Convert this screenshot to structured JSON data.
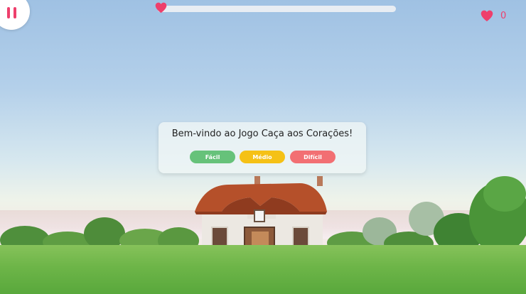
{
  "hud": {
    "pause_icon": "pause-icon",
    "progress_fraction": 0.02,
    "progress_icon": "heart-icon",
    "hearts_icon": "heart-icon",
    "hearts_count": "0"
  },
  "dialog": {
    "title": "Bem-vindo ao Jogo Caça aos Corações!",
    "buttons": [
      {
        "label": "Fácil",
        "color": "#66c27a"
      },
      {
        "label": "Médio",
        "color": "#f5c116"
      },
      {
        "label": "Difícil",
        "color": "#f26f73"
      }
    ]
  },
  "colors": {
    "accent": "#ee3f6c",
    "sky": "#a9c8e6",
    "grass": "#6db548"
  }
}
